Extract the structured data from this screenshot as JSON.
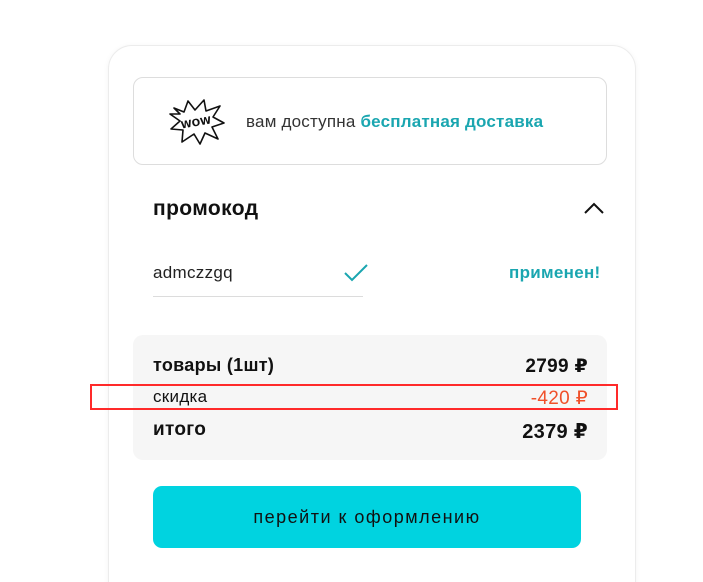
{
  "banner": {
    "text_prefix": "вам доступна",
    "text_highlight": "бесплатная доставка",
    "icon": "wow-sticker-icon",
    "icon_text": "WOW"
  },
  "promo": {
    "title": "промокод",
    "code_value": "admczzgq",
    "status": "применен!",
    "check_icon": "check-icon",
    "toggle_icon": "chevron-up-icon"
  },
  "summary": {
    "goods_label": "товары (1шт)",
    "goods_value": "2799 ₽",
    "discount_label": "скидка",
    "discount_value": "-420 ₽",
    "total_label": "итого",
    "total_value": "2379 ₽"
  },
  "checkout": {
    "button_label": "перейти к оформлению"
  },
  "colors": {
    "accent": "#1aa6b0",
    "button": "#00d3e0",
    "discount": "#f0502a",
    "annotation": "#ff2a2a"
  }
}
